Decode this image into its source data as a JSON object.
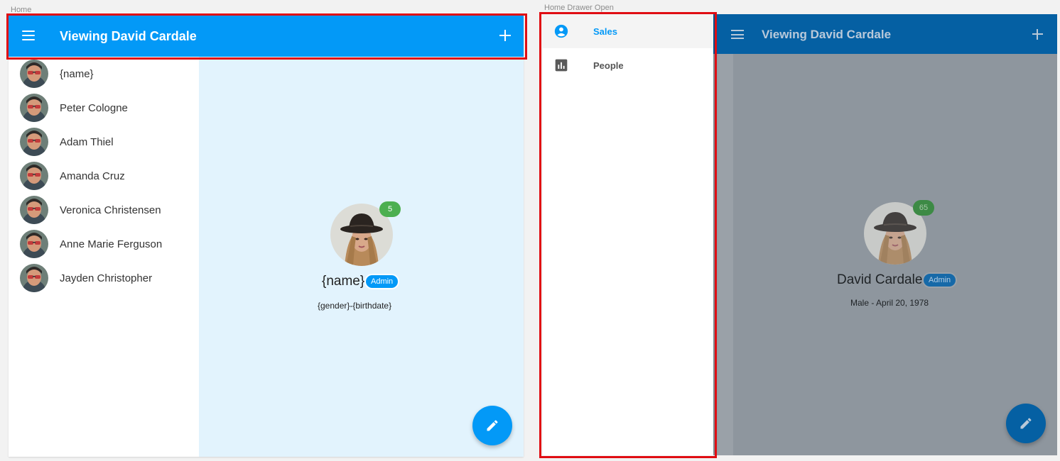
{
  "labels": {
    "home": "Home",
    "home_drawer_open": "Home Drawer Open"
  },
  "home_screen": {
    "appbar": {
      "title": "Viewing David Cardale",
      "menu_icon": "menu-icon",
      "add_icon": "plus-icon"
    },
    "people": [
      {
        "name": "{name}"
      },
      {
        "name": "Peter Cologne"
      },
      {
        "name": "Adam Thiel"
      },
      {
        "name": "Amanda Cruz"
      },
      {
        "name": "Veronica Christensen"
      },
      {
        "name": "Anne Marie Ferguson"
      },
      {
        "name": "Jayden Christopher"
      }
    ],
    "profile": {
      "count": "5",
      "name": "{name}",
      "role": "Admin",
      "info": "{gender}-{birthdate}"
    },
    "fab_icon": "pencil-icon"
  },
  "drawer_screen": {
    "appbar": {
      "title": "Viewing David Cardale"
    },
    "drawer_items": [
      {
        "label": "Sales",
        "icon": "account-circle-icon",
        "active": true
      },
      {
        "label": "People",
        "icon": "bar-chart-icon",
        "active": false
      }
    ],
    "profile": {
      "count": "65",
      "name": "David Cardale",
      "role": "Admin",
      "info": "Male - April 20, 1978"
    }
  },
  "colors": {
    "primary": "#0399f7",
    "primary_dark": "#0560a3",
    "detail_bg": "#e2f3fd",
    "badge_green": "#4caf50",
    "highlight_red": "#e00d13",
    "scrim": "#8e969e"
  }
}
